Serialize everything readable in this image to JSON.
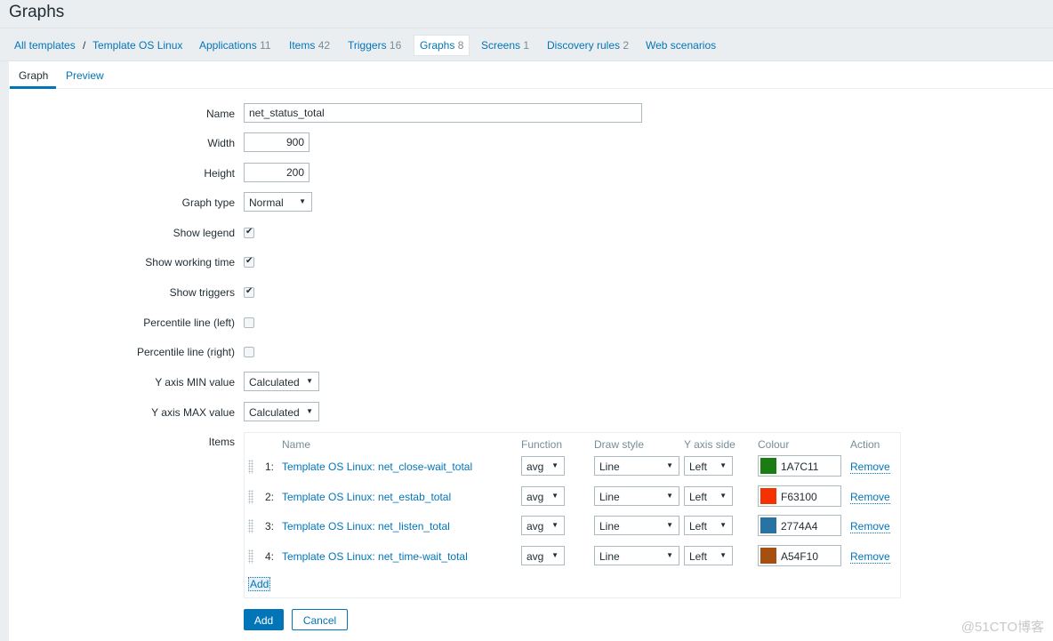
{
  "page_title": "Graphs",
  "nav": {
    "breadcrumb_root": "All templates",
    "breadcrumb_sep": "/",
    "template": "Template OS Linux",
    "links": [
      {
        "label": "Applications",
        "count": "11"
      },
      {
        "label": "Items",
        "count": "42"
      },
      {
        "label": "Triggers",
        "count": "16"
      },
      {
        "label": "Graphs",
        "count": "8",
        "active": true
      },
      {
        "label": "Screens",
        "count": "1"
      },
      {
        "label": "Discovery rules",
        "count": "2"
      },
      {
        "label": "Web scenarios",
        "count": ""
      }
    ]
  },
  "tabs": [
    {
      "label": "Graph",
      "active": true
    },
    {
      "label": "Preview",
      "active": false
    }
  ],
  "form": {
    "name_label": "Name",
    "name_value": "net_status_total",
    "width_label": "Width",
    "width_value": "900",
    "height_label": "Height",
    "height_value": "200",
    "graph_type_label": "Graph type",
    "graph_type_value": "Normal",
    "show_legend_label": "Show legend",
    "show_legend": true,
    "show_working_time_label": "Show working time",
    "show_working_time": true,
    "show_triggers_label": "Show triggers",
    "show_triggers": true,
    "percentile_left_label": "Percentile line (left)",
    "percentile_left": false,
    "percentile_right_label": "Percentile line (right)",
    "percentile_right": false,
    "ymin_label": "Y axis MIN value",
    "ymin_value": "Calculated",
    "ymax_label": "Y axis MAX value",
    "ymax_value": "Calculated",
    "items_label": "Items"
  },
  "items_table": {
    "headers": {
      "name": "Name",
      "function": "Function",
      "draw_style": "Draw style",
      "y_axis_side": "Y axis side",
      "colour": "Colour",
      "action": "Action"
    },
    "rows": [
      {
        "num": "1:",
        "name": "Template OS Linux: net_close-wait_total",
        "function": "avg",
        "draw_style": "Line",
        "y_axis_side": "Left",
        "colour": "1A7C11",
        "colour_hex": "#1A7C11",
        "action": "Remove"
      },
      {
        "num": "2:",
        "name": "Template OS Linux: net_estab_total",
        "function": "avg",
        "draw_style": "Line",
        "y_axis_side": "Left",
        "colour": "F63100",
        "colour_hex": "#F63100",
        "action": "Remove"
      },
      {
        "num": "3:",
        "name": "Template OS Linux: net_listen_total",
        "function": "avg",
        "draw_style": "Line",
        "y_axis_side": "Left",
        "colour": "2774A4",
        "colour_hex": "#2774A4",
        "action": "Remove"
      },
      {
        "num": "4:",
        "name": "Template OS Linux: net_time-wait_total",
        "function": "avg",
        "draw_style": "Line",
        "y_axis_side": "Left",
        "colour": "A54F10",
        "colour_hex": "#A54F10",
        "action": "Remove"
      }
    ],
    "add_link": "Add"
  },
  "buttons": {
    "add": "Add",
    "cancel": "Cancel"
  },
  "watermark": "@51CTO博客",
  "icons": {
    "select_arrow": "▼",
    "check": "✔"
  }
}
